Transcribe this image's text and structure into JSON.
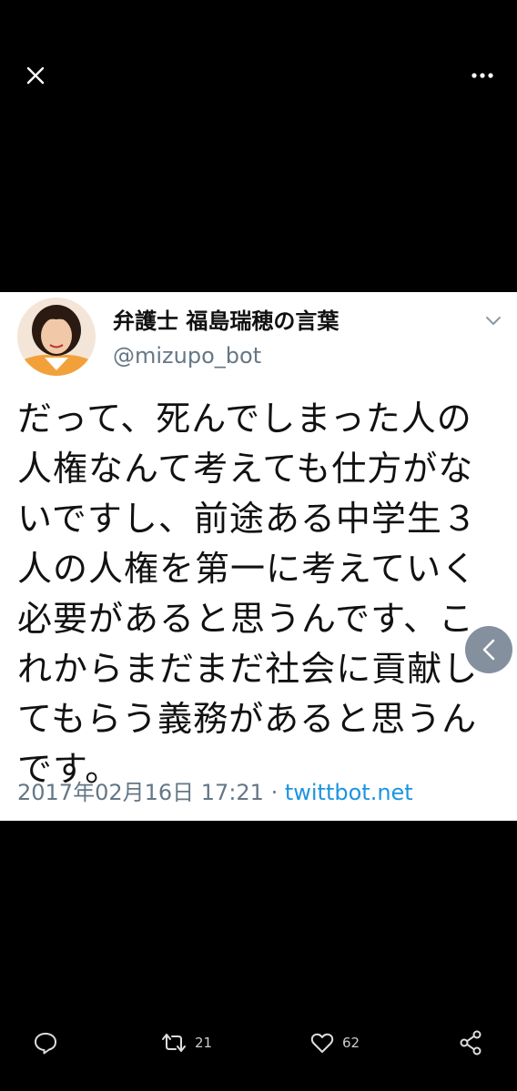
{
  "topbar": {
    "close_icon": "close-icon",
    "more_icon": "more-icon"
  },
  "tweet": {
    "display_name": "弁護士 福島瑞穂の言葉",
    "handle": "@mizupo_bot",
    "text": "だって、死んでしまった人の人権なんて考えても仕方がないですし、前途ある中学生３人の人権を第一に考えていく必要があると思うんです、これからまだまだ社会に貢献してもらう義務があると思うんです。",
    "timestamp": "2017年02月16日 17:21",
    "separator": " · ",
    "source": "twittbot.net"
  },
  "actions": {
    "retweet_count": "21",
    "like_count": "62"
  },
  "colors": {
    "background": "#000000",
    "card": "#ffffff",
    "meta_gray": "#657786",
    "link_blue": "#1b95e0"
  }
}
